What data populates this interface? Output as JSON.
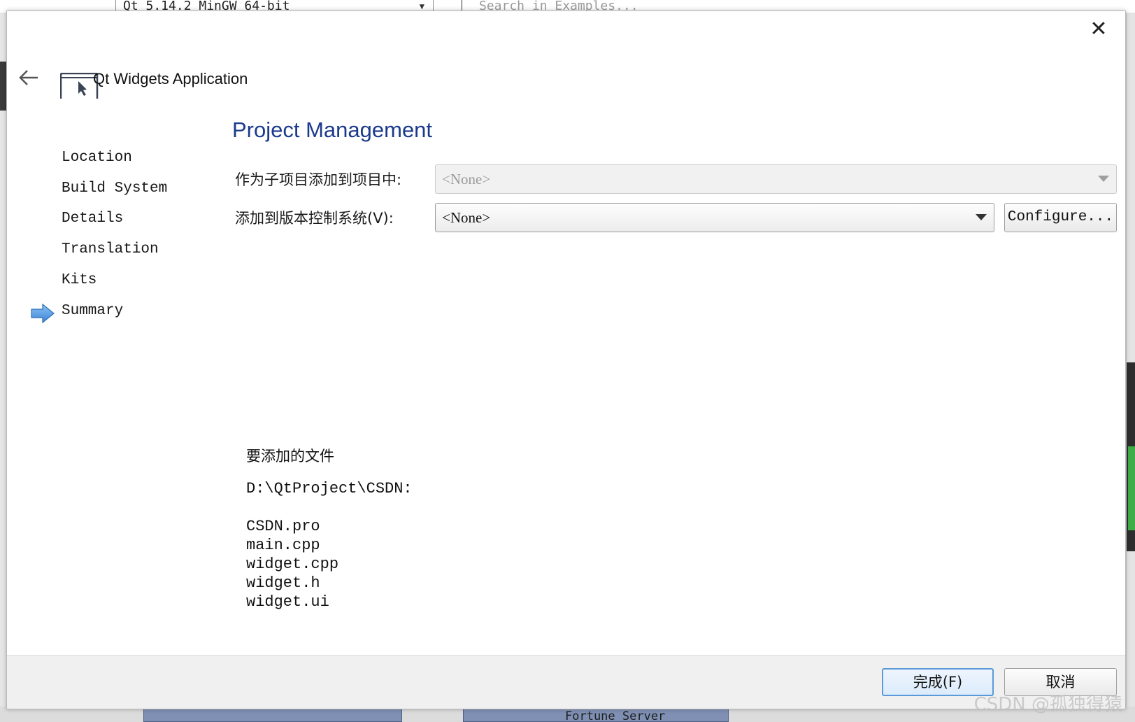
{
  "background": {
    "kit_selector": "Qt 5.14.2 MinGW 64-bit",
    "search_placeholder": "Search in Examples...",
    "bottom_tile_label": "Fortune Server"
  },
  "dialog": {
    "close_label": "✕",
    "app_title": "Qt Widgets Application",
    "steps": [
      {
        "label": "Location",
        "current": false
      },
      {
        "label": "Build System",
        "current": false
      },
      {
        "label": "Details",
        "current": false
      },
      {
        "label": "Translation",
        "current": false
      },
      {
        "label": "Kits",
        "current": false
      },
      {
        "label": "Summary",
        "current": true
      }
    ],
    "page_title": "Project Management",
    "form": {
      "subproject_label": "作为子项目添加到项目中:",
      "subproject_value": "<None>",
      "vcs_label": "添加到版本控制系统(V):",
      "vcs_value": "<None>",
      "configure_label": "Configure..."
    },
    "summary": {
      "heading": "要添加的文件",
      "path": "D:\\QtProject\\CSDN:",
      "files": [
        "CSDN.pro",
        "main.cpp",
        "widget.cpp",
        "widget.h",
        "widget.ui"
      ]
    },
    "footer": {
      "finish_label": "完成(F)",
      "cancel_label": "取消"
    }
  },
  "watermark": "CSDN @孤独得猿",
  "colors": {
    "title_blue": "#1b3a8c",
    "arrow_blue": "#4a90e2",
    "default_button_border": "#5b9ad9"
  }
}
